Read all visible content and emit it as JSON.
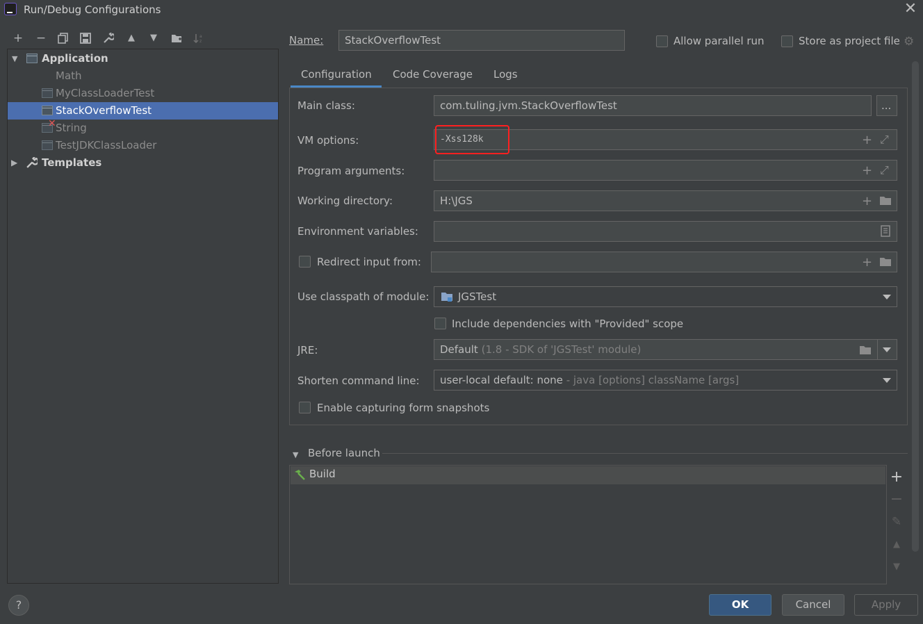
{
  "window": {
    "title": "Run/Debug Configurations",
    "close": "✕"
  },
  "toolbar": {
    "add": "+",
    "remove": "−",
    "copy": "copy-icon",
    "save": "save-icon",
    "edit_defaults": "wrench-icon",
    "move_up": "▲",
    "move_down": "▼",
    "new_folder": "folder-add-icon",
    "sort": "sort-icon"
  },
  "tree": {
    "application": "Application",
    "items": [
      "Math",
      "MyClassLoaderTest",
      "StackOverflowTest",
      "String",
      "TestJDKClassLoader"
    ],
    "templates": "Templates"
  },
  "header": {
    "name_label": "Name:",
    "name_value": "StackOverflowTest",
    "allow_parallel": "Allow parallel run",
    "store_project": "Store as project file"
  },
  "tabs": [
    "Configuration",
    "Code Coverage",
    "Logs"
  ],
  "form": {
    "main_class_label": "Main class:",
    "main_class_value": "com.tuling.jvm.StackOverflowTest",
    "browse": "...",
    "vm_options_label": "VM options:",
    "vm_options_value": "-Xss128k",
    "program_args_label": "Program arguments:",
    "working_dir_label": "Working directory:",
    "working_dir_value": "H:\\JGS",
    "env_vars_label": "Environment variables:",
    "redirect_label": "Redirect input from:",
    "classpath_label": "Use classpath of module:",
    "classpath_value": "JGSTest",
    "include_deps": "Include dependencies with \"Provided\" scope",
    "jre_label": "JRE:",
    "jre_value": "Default",
    "jre_hint": "(1.8 - SDK of 'JGSTest' module)",
    "shorten_label": "Shorten command line:",
    "shorten_value": "user-local default: none",
    "shorten_hint": "- java [options] className [args]",
    "snapshots": "Enable capturing form snapshots"
  },
  "before_launch": {
    "title": "Before launch",
    "items": [
      "Build"
    ]
  },
  "buttons": {
    "ok": "OK",
    "cancel": "Cancel",
    "apply": "Apply",
    "help": "?"
  }
}
